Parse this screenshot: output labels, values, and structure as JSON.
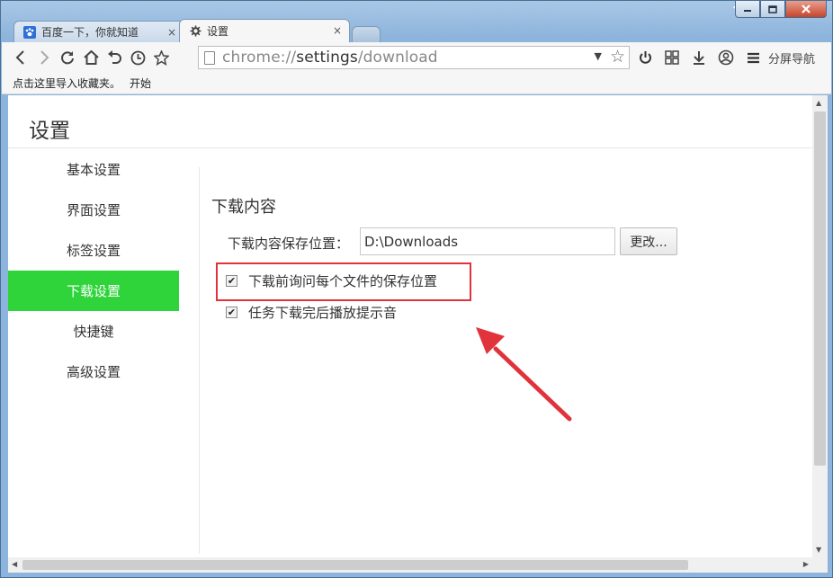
{
  "window": {
    "minimize": "▭",
    "restore": "▢",
    "close": "✕",
    "skin_icon": "shirt-icon"
  },
  "tabs": [
    {
      "title": "百度一下，你就知道",
      "icon": "paw-icon",
      "close": "×"
    },
    {
      "title": "设置",
      "icon": "gear-icon",
      "close": "×"
    }
  ],
  "toolbar": {
    "back": "‹",
    "forward": "›",
    "reload": "C",
    "home": "⌂",
    "undo": "↶",
    "history": "◷",
    "favorite": "☆",
    "url_scheme": "chrome://",
    "url_host": "settings",
    "url_path": "/download",
    "dropdown": "▼",
    "star": "☆",
    "power": "⏻",
    "apps": "⊞",
    "download": "⤓",
    "user": "☺",
    "menu": "≡",
    "split_nav": "分屏导航"
  },
  "bookmarks": {
    "import_text": "点击这里导入收藏夹。",
    "start": "开始"
  },
  "settings": {
    "page_title": "设置",
    "nav": [
      "基本设置",
      "界面设置",
      "标签设置",
      "下载设置",
      "快捷键",
      "高级设置"
    ],
    "active_nav": "下载设置",
    "section_title": "下载内容",
    "location_label": "下载内容保存位置：",
    "location_value": "D:\\Downloads",
    "change_button": "更改...",
    "ask_location_label": "下载前询问每个文件的保存位置",
    "ask_location_checked": true,
    "sound_label": "任务下载完后播放提示音",
    "sound_checked": true,
    "check_mark": "✔"
  },
  "colors": {
    "active_nav": "#2ed43a",
    "highlight": "#e0333b"
  }
}
